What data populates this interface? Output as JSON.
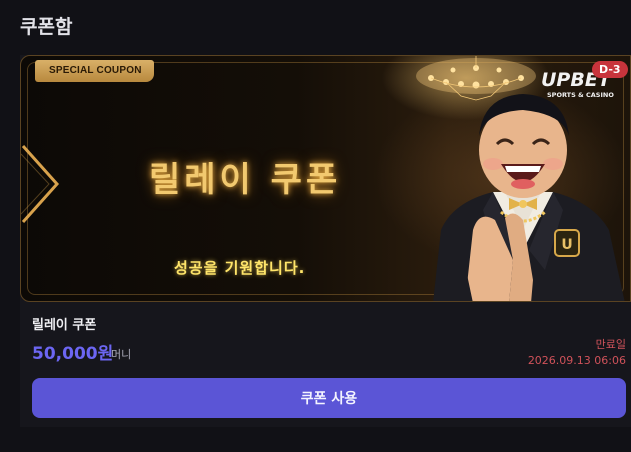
{
  "page": {
    "title": "쿠폰함"
  },
  "coupon": {
    "banner": {
      "tag": "SPECIAL COUPON",
      "title": "릴레이 쿠폰",
      "subtitle": "성공을 기원합니다.",
      "brand_line1": "UPBET",
      "brand_line2": "SPORTS & CASINO",
      "days_left": "D-3"
    },
    "name": "릴레이 쿠폰",
    "amount": "50,000원",
    "unit": "머니",
    "expire_label": "만료일",
    "expire_date": "2026.09.13 06:06",
    "use_button": "쿠폰 사용"
  },
  "colors": {
    "accent": "#5b55d6",
    "amount": "#6c66f2",
    "expire": "#d0525a",
    "gold": "#f2c96f"
  }
}
